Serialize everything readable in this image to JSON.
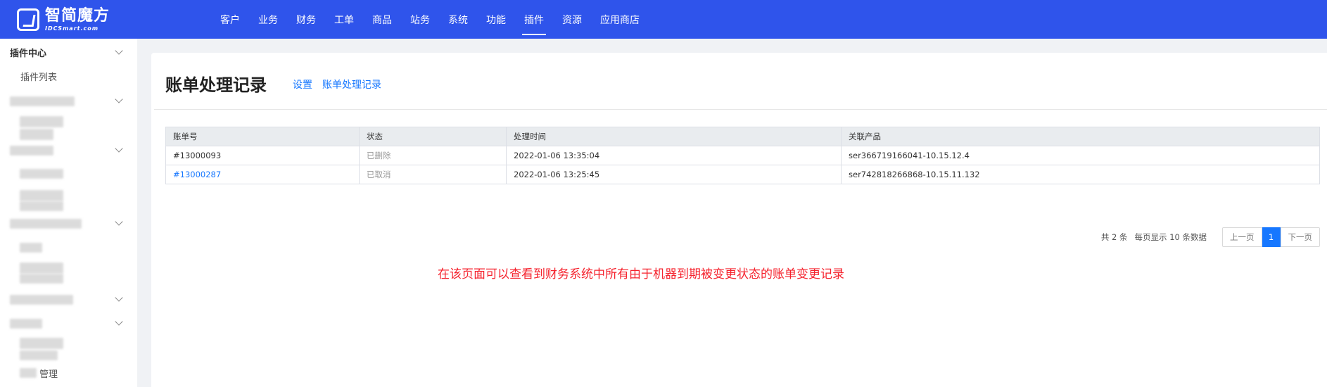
{
  "brand": {
    "name_cn": "智简魔方",
    "name_en": "IDCSmart.com"
  },
  "nav": [
    {
      "label": "客户"
    },
    {
      "label": "业务"
    },
    {
      "label": "财务"
    },
    {
      "label": "工单"
    },
    {
      "label": "商品"
    },
    {
      "label": "站务"
    },
    {
      "label": "系统"
    },
    {
      "label": "功能"
    },
    {
      "label": "插件",
      "active": true
    },
    {
      "label": "资源"
    },
    {
      "label": "应用商店"
    }
  ],
  "sidebar": {
    "group": "插件中心",
    "item": "插件列表",
    "last_item_partial": "管理"
  },
  "page": {
    "title": "账单处理记录",
    "tabs": [
      "设置",
      "账单处理记录"
    ]
  },
  "table": {
    "columns": [
      "账单号",
      "状态",
      "处理时间",
      "关联产品"
    ],
    "rows": [
      {
        "invoice": "#13000093",
        "status": "已删除",
        "time": "2022-01-06 13:35:04",
        "product": "ser366719166041-10.15.12.4",
        "link": false
      },
      {
        "invoice": "#13000287",
        "status": "已取消",
        "time": "2022-01-06 13:25:45",
        "product": "ser742818266868-10.15.11.132",
        "link": true
      }
    ]
  },
  "pagination": {
    "total_text": "共 2 条",
    "per_page_text": "每页显示 10 条数据",
    "prev": "上一页",
    "current": "1",
    "next": "下一页"
  },
  "annotation": "在该页面可以查看到财务系统中所有由于机器到期被变更状态的账单变更记录",
  "colors": {
    "primary_bar": "#2f54eb",
    "link": "#1677ff",
    "note": "#f5222d"
  }
}
